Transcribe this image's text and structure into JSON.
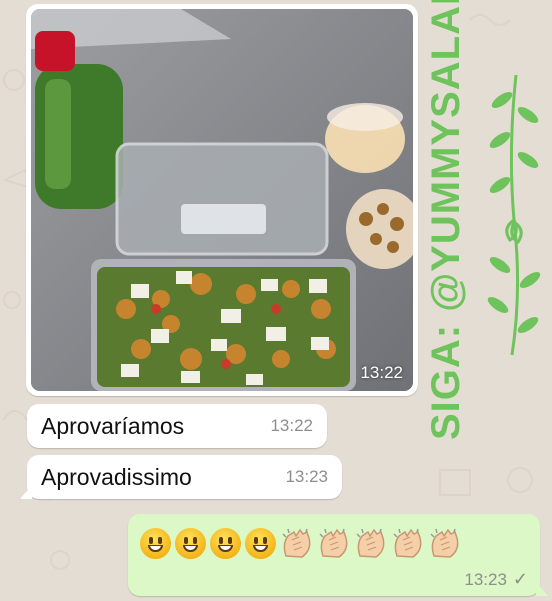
{
  "messages": {
    "photo": {
      "time": "13:22"
    },
    "incoming": [
      {
        "text": "Aprovaríamos",
        "time": "13:22"
      },
      {
        "text": "Aprovadissimo",
        "time": "13:23"
      }
    ],
    "outgoing": {
      "smileys": 4,
      "claps": 5,
      "time": "13:23",
      "status_icon": "single-check-icon"
    }
  },
  "overlay": {
    "text": "SIGA: @YUMMYSALADA",
    "color": "#6fc35c"
  },
  "colors": {
    "background": "#e4ddd3",
    "incoming_bubble": "#ffffff",
    "outgoing_bubble": "#dcf8c6"
  }
}
